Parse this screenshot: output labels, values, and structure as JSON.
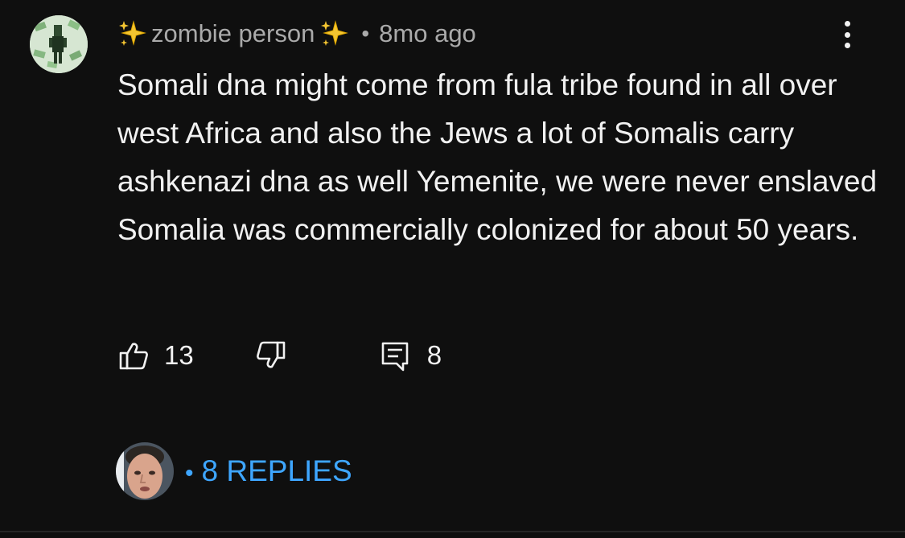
{
  "comment": {
    "author": "zombie person",
    "author_icon_left": "sparkles-icon",
    "author_icon_right": "sparkles-icon",
    "separator": "•",
    "timestamp": "8mo ago",
    "text": "Somali dna might come from fula tribe found in all over west Africa and also the Jews a lot of Somalis carry ashkenazi dna as well Yemenite, we were never enslaved Somalia was commercially colonized for about 50 years.",
    "likes": "13",
    "replies_count": "8"
  },
  "replies": {
    "separator": "•",
    "label": "8 REPLIES"
  },
  "colors": {
    "background": "#0f0f0f",
    "text": "#f1f1f1",
    "muted": "#aaaaaa",
    "link": "#3ea6ff"
  }
}
